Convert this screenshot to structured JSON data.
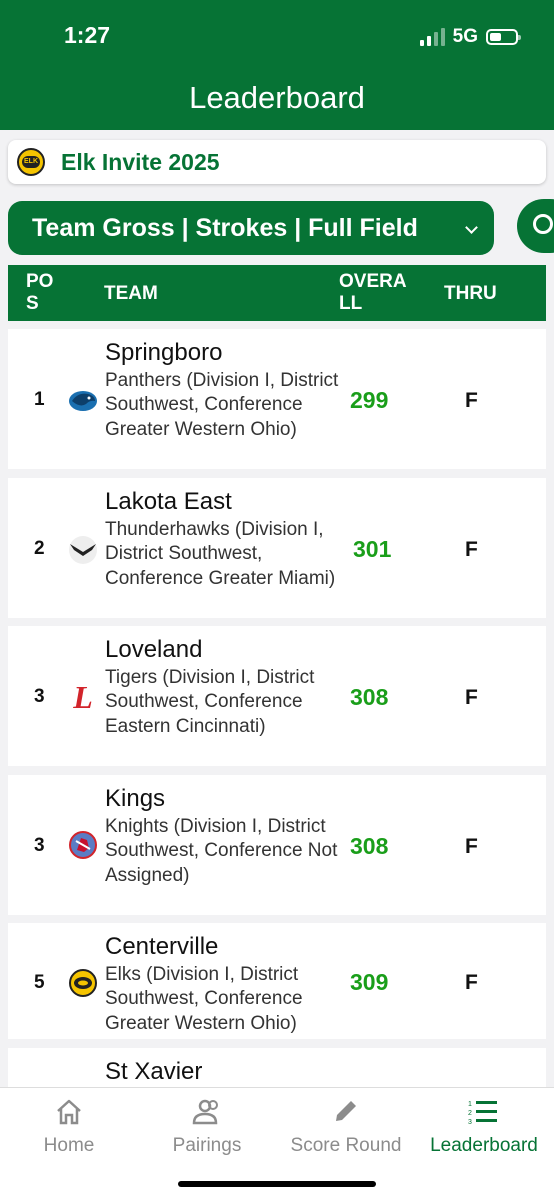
{
  "status": {
    "time": "1:27",
    "network": "5G"
  },
  "header": {
    "title": "Leaderboard"
  },
  "event": {
    "name": "Elk Invite 2025",
    "logo_text": "ELK"
  },
  "filter": {
    "label": "Team Gross | Strokes | Full Field"
  },
  "table": {
    "headers": {
      "pos": "POS",
      "team": "TEAM",
      "overall": "OVERALL",
      "thru": "THRU"
    },
    "rows": [
      {
        "pos": "1",
        "name": "Springboro",
        "detail": "Panthers (Division I, District Southwest, Conference Greater Western Ohio)",
        "score": "299",
        "thru": "F",
        "logo": "panther-icon"
      },
      {
        "pos": "2",
        "name": "Lakota East",
        "detail": "Thunderhawks (Division I, District Southwest, Conference Greater Miami)",
        "score": "301",
        "thru": "F",
        "logo": "hawk-icon"
      },
      {
        "pos": "3",
        "name": "Loveland",
        "detail": "Tigers (Division I, District Southwest, Conference Eastern Cincinnati)",
        "score": "308",
        "thru": "F",
        "logo": "letter-l-icon",
        "logo_text": "L"
      },
      {
        "pos": "3",
        "name": "Kings",
        "detail": "Knights (Division I, District Southwest, Conference Not Assigned)",
        "score": "308",
        "thru": "F",
        "logo": "knight-icon"
      },
      {
        "pos": "5",
        "name": "Centerville",
        "detail": "Elks (Division I, District Southwest, Conference Greater Western Ohio)",
        "score": "309",
        "thru": "F",
        "logo": "elk-icon"
      },
      {
        "name": "St Xavier"
      }
    ]
  },
  "tabs": [
    {
      "label": "Home",
      "icon": "home-icon"
    },
    {
      "label": "Pairings",
      "icon": "people-icon"
    },
    {
      "label": "Score Round",
      "icon": "pencil-icon"
    },
    {
      "label": "Leaderboard",
      "icon": "list-icon",
      "active": true
    }
  ],
  "colors": {
    "brand": "#067335",
    "score": "#1a9e1a",
    "inactive_tab": "#8c8c8c"
  }
}
